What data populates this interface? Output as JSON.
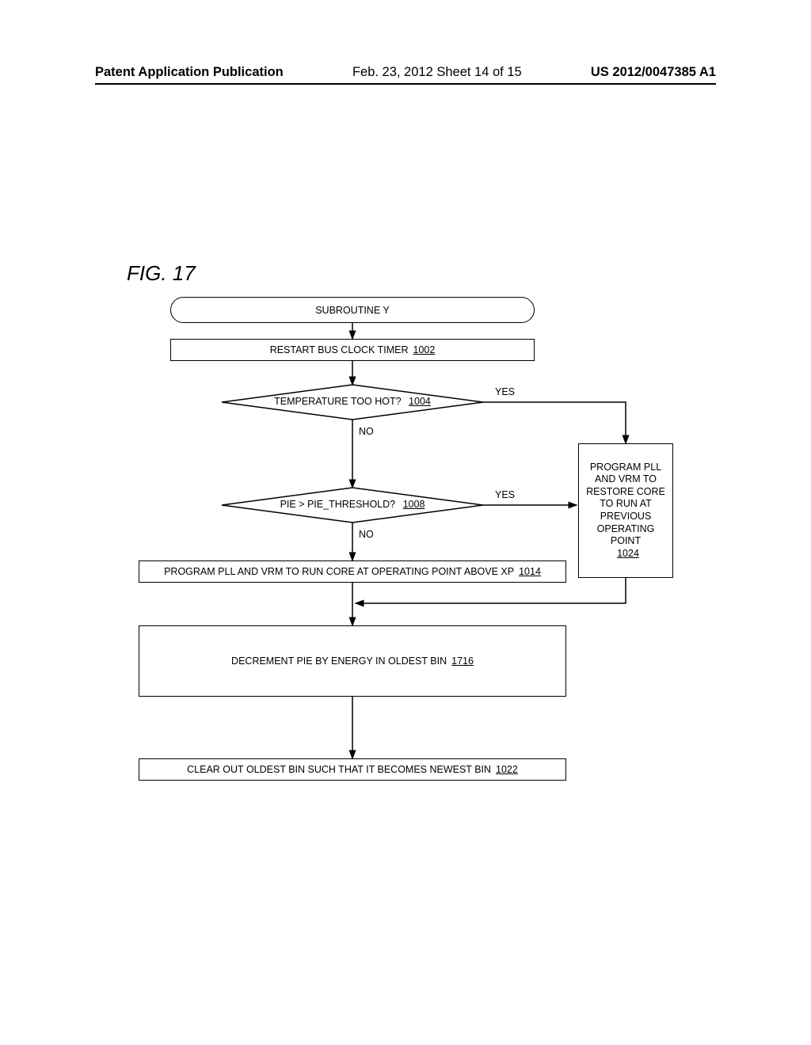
{
  "header": {
    "left": "Patent Application Publication",
    "center": "Feb. 23, 2012  Sheet 14 of 15",
    "right": "US 2012/0047385 A1"
  },
  "figure_label": "FIG. 17",
  "nodes": {
    "start": {
      "text": "SUBROUTINE Y"
    },
    "n1002": {
      "text": "RESTART BUS CLOCK TIMER",
      "ref": "1002"
    },
    "d1004": {
      "text": "TEMPERATURE TOO HOT?",
      "ref": "1004",
      "yes": "YES",
      "no": "NO"
    },
    "d1008": {
      "text": "PIE > PIE_THRESHOLD?",
      "ref": "1008",
      "yes": "YES",
      "no": "NO"
    },
    "n1014": {
      "text": "PROGRAM PLL AND VRM TO RUN CORE AT OPERATING POINT ABOVE XP",
      "ref": "1014"
    },
    "n1024": {
      "text": "PROGRAM PLL AND VRM TO RESTORE CORE TO RUN AT PREVIOUS OPERATING POINT",
      "ref": "1024"
    },
    "n1716": {
      "text": "DECREMENT PIE BY ENERGY IN OLDEST BIN",
      "ref": "1716"
    },
    "n1022": {
      "text": "CLEAR OUT OLDEST BIN SUCH THAT IT BECOMES NEWEST BIN",
      "ref": "1022"
    }
  },
  "chart_data": {
    "type": "flowchart",
    "title": "FIG. 17 — Subroutine Y",
    "nodes": [
      {
        "id": "start",
        "shape": "terminator",
        "label": "SUBROUTINE Y"
      },
      {
        "id": "1002",
        "shape": "process",
        "label": "RESTART BUS CLOCK TIMER 1002"
      },
      {
        "id": "1004",
        "shape": "decision",
        "label": "TEMPERATURE TOO HOT? 1004"
      },
      {
        "id": "1008",
        "shape": "decision",
        "label": "PIE > PIE_THRESHOLD? 1008"
      },
      {
        "id": "1014",
        "shape": "process",
        "label": "PROGRAM PLL AND VRM TO RUN CORE AT OPERATING POINT ABOVE XP 1014"
      },
      {
        "id": "1024",
        "shape": "process",
        "label": "PROGRAM PLL AND VRM TO RESTORE CORE TO RUN AT PREVIOUS OPERATING POINT 1024"
      },
      {
        "id": "1716",
        "shape": "process",
        "label": "DECREMENT PIE BY ENERGY IN OLDEST BIN 1716"
      },
      {
        "id": "1022",
        "shape": "process",
        "label": "CLEAR OUT OLDEST BIN SUCH THAT IT BECOMES NEWEST BIN 1022"
      }
    ],
    "edges": [
      {
        "from": "start",
        "to": "1002"
      },
      {
        "from": "1002",
        "to": "1004"
      },
      {
        "from": "1004",
        "to": "1024",
        "label": "YES"
      },
      {
        "from": "1004",
        "to": "1008",
        "label": "NO"
      },
      {
        "from": "1008",
        "to": "1024",
        "label": "YES"
      },
      {
        "from": "1008",
        "to": "1014",
        "label": "NO"
      },
      {
        "from": "1014",
        "to": "1716"
      },
      {
        "from": "1024",
        "to": "1716"
      },
      {
        "from": "1716",
        "to": "1022"
      }
    ]
  }
}
